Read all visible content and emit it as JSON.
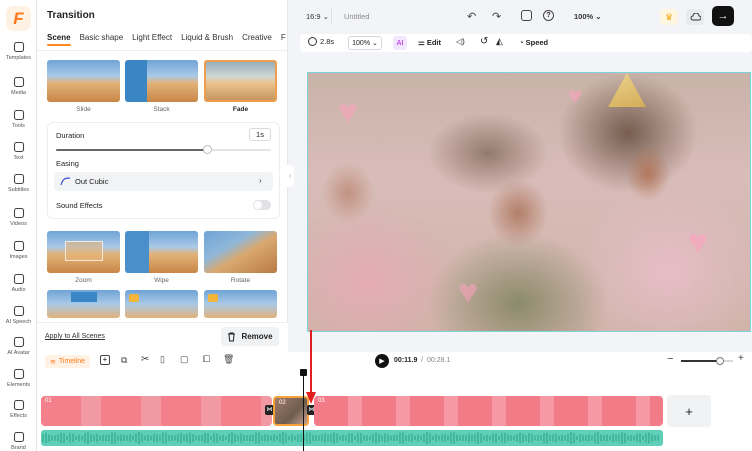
{
  "app": {
    "logo_letter": "F"
  },
  "rail": [
    {
      "label": "Templates",
      "icon": "templates-icon"
    },
    {
      "label": "Media",
      "icon": "media-icon"
    },
    {
      "label": "Tools",
      "icon": "ai-tools-icon"
    },
    {
      "label": "Text",
      "icon": "text-icon"
    },
    {
      "label": "Subtitles",
      "icon": "subtitles-icon"
    },
    {
      "label": "Videos",
      "icon": "videos-icon"
    },
    {
      "label": "Images",
      "icon": "images-icon"
    },
    {
      "label": "Audio",
      "icon": "audio-icon"
    },
    {
      "label": "AI Speech",
      "icon": "ai-speech-icon"
    },
    {
      "label": "AI Avatar",
      "icon": "ai-avatar-icon"
    },
    {
      "label": "Elements",
      "icon": "elements-icon"
    },
    {
      "label": "Effects",
      "icon": "effects-icon"
    },
    {
      "label": "Brand",
      "icon": "brand-icon"
    }
  ],
  "panel": {
    "title": "Transition",
    "tabs": [
      "Scene",
      "Basic shape",
      "Light Effect",
      "Liquid & Brush",
      "Creative",
      "F"
    ],
    "transitions_row1": [
      "Slide",
      "Stack",
      "Fade"
    ],
    "transitions_row2": [
      "Zoom",
      "Wipe",
      "Rotate"
    ],
    "duration_label": "Duration",
    "duration_value": "1s",
    "duration_fraction": 0.7,
    "easing_label": "Easing",
    "easing_value": "Out Cubic",
    "sound_effects_label": "Sound Effects",
    "sound_effects_on": false,
    "apply_all": "Apply to All Scenes",
    "remove_label": "Remove"
  },
  "topbar": {
    "aspect_ratio": "16:9",
    "project_name": "Untitled",
    "zoom": "100%"
  },
  "preview_toolbar": {
    "duration": "2.8s",
    "zoom": "100%",
    "edit_label": "Edit",
    "speed_label": "Speed"
  },
  "timeline": {
    "label": "Timeline",
    "current_time": "00:11.9",
    "total_time": "00:28.1",
    "clips": [
      "01",
      "02",
      "03"
    ],
    "zoom_fraction": 0.75
  },
  "colors": {
    "accent": "#ff8a1e",
    "clip_pink": "#f0707e",
    "audio_green": "#5fcfb7",
    "selection": "#7fd4e0"
  }
}
